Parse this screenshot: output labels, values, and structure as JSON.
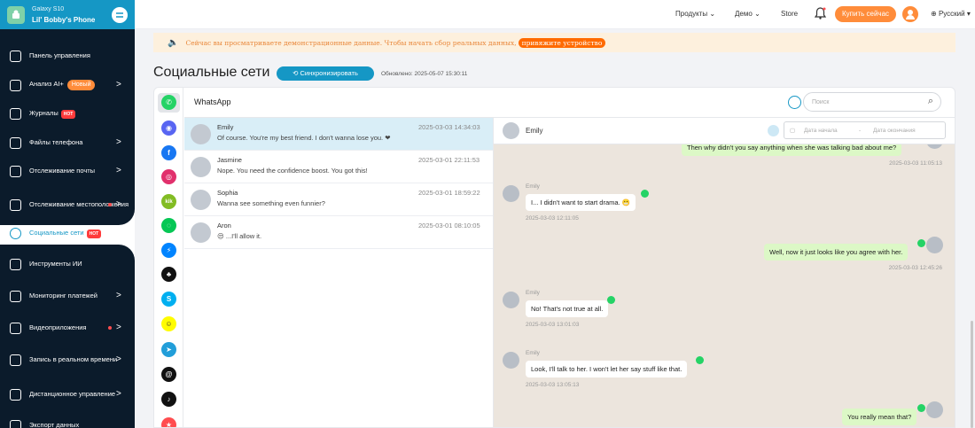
{
  "device": {
    "model": "Galaxy S10",
    "name": "Lil' Bobby's Phone"
  },
  "nav": [
    {
      "label": "Панель управления",
      "chev": "",
      "dot": false
    },
    {
      "label": "Анализ AI+",
      "badge": "Новый",
      "chev": ">",
      "dot": false
    },
    {
      "label": "Журналы",
      "hot": "HOT",
      "chev": "",
      "dot": false
    },
    {
      "label": "Файлы телефона",
      "chev": ">",
      "dot": false
    },
    {
      "label": "Отслеживание почты",
      "chev": ">",
      "dot": false
    },
    {
      "label": "Отслеживание местоположения",
      "chev": ">",
      "dot": true
    },
    {
      "label": "Социальные сети",
      "hot": "HOT",
      "chev": "",
      "dot": false
    },
    {
      "label": "Инструменты ИИ",
      "chev": "",
      "dot": false
    },
    {
      "label": "Мониторинг платежей",
      "chev": ">",
      "dot": false
    },
    {
      "label": "Видеоприложения",
      "chev": ">",
      "dot": true
    },
    {
      "label": "Запись в реальном времени",
      "chev": ">",
      "dot": false
    },
    {
      "label": "Дистанционное управление",
      "chev": ">",
      "dot": false
    },
    {
      "label": "Экспорт данных",
      "chev": "",
      "dot": false
    }
  ],
  "topbar": {
    "products": "Продукты",
    "demo": "Демо",
    "store": "Store",
    "buy": "Купить сейчас",
    "lang": "Русский"
  },
  "banner": {
    "text": "Сейчас вы просматриваете демонстрационные данные. Чтобы начать сбор реальных данных,",
    "link": "привяжите устройство"
  },
  "page": {
    "title": "Социальные сети",
    "sync": "Синхронизировать",
    "updated": "Обновлено: 2025-05-07 15:30:11"
  },
  "apps": [
    {
      "name": "whatsapp",
      "color": "#25d366",
      "glyph": "✆"
    },
    {
      "name": "discord",
      "color": "#5865f2",
      "glyph": "◉"
    },
    {
      "name": "facebook",
      "color": "#1877f2",
      "glyph": "f"
    },
    {
      "name": "instagram",
      "color": "#e1306c",
      "glyph": "◎"
    },
    {
      "name": "kik",
      "color": "#82bc23",
      "glyph": "kik"
    },
    {
      "name": "line",
      "color": "#06c755",
      "glyph": "◌"
    },
    {
      "name": "messenger",
      "color": "#0084ff",
      "glyph": "⚡"
    },
    {
      "name": "qq",
      "color": "#111111",
      "glyph": "♣"
    },
    {
      "name": "skype",
      "color": "#00aff0",
      "glyph": "S"
    },
    {
      "name": "snapchat",
      "color": "#fffc00",
      "glyph": "☺"
    },
    {
      "name": "telegram",
      "color": "#229ed9",
      "glyph": "➤"
    },
    {
      "name": "threads",
      "color": "#111111",
      "glyph": "@"
    },
    {
      "name": "tiktok",
      "color": "#111111",
      "glyph": "♪"
    },
    {
      "name": "other",
      "color": "#ff4d4f",
      "glyph": "★"
    }
  ],
  "panel": {
    "title": "WhatsApp",
    "search_placeholder": "Поиск"
  },
  "chats": [
    {
      "name": "Emily",
      "msg": "Of course. You're my best friend. I don't wanna lose you. ❤",
      "time": "2025-03-03 14:34:03"
    },
    {
      "name": "Jasmine",
      "msg": "Nope. You need the confidence boost. You got this!",
      "time": "2025-03-01 22:11:53"
    },
    {
      "name": "Sophia",
      "msg": "Wanna see something even funnier?",
      "time": "2025-03-01 18:59:22"
    },
    {
      "name": "Aron",
      "msg": "😒 ...I'll allow it.",
      "time": "2025-03-01 08:10:05"
    }
  ],
  "conversation": {
    "name": "Emily",
    "date_start": "Дата начала",
    "date_sep": "-",
    "date_end": "Дата окончания",
    "messages": [
      {
        "dir": "out",
        "sender": "",
        "text": "Then why didn't you say anything when she was talking bad about me?",
        "time": "2025-03-03 11:05:13"
      },
      {
        "dir": "in",
        "sender": "Emily",
        "text": "I... I didn't want to start drama. 😬",
        "time": "2025-03-03 12:11:05"
      },
      {
        "dir": "out",
        "sender": "",
        "text": "Well, now it just looks like you agree with her.",
        "time": "2025-03-03 12:45:26"
      },
      {
        "dir": "in",
        "sender": "Emily",
        "text": "No! That's not true at all.",
        "time": "2025-03-03 13:01:03"
      },
      {
        "dir": "in",
        "sender": "Emily",
        "text": "Look, I'll talk to her. I won't let her say stuff like that.",
        "time": "2025-03-03 13:05:13"
      },
      {
        "dir": "out",
        "sender": "",
        "text": "You really mean that?",
        "time": ""
      }
    ]
  }
}
